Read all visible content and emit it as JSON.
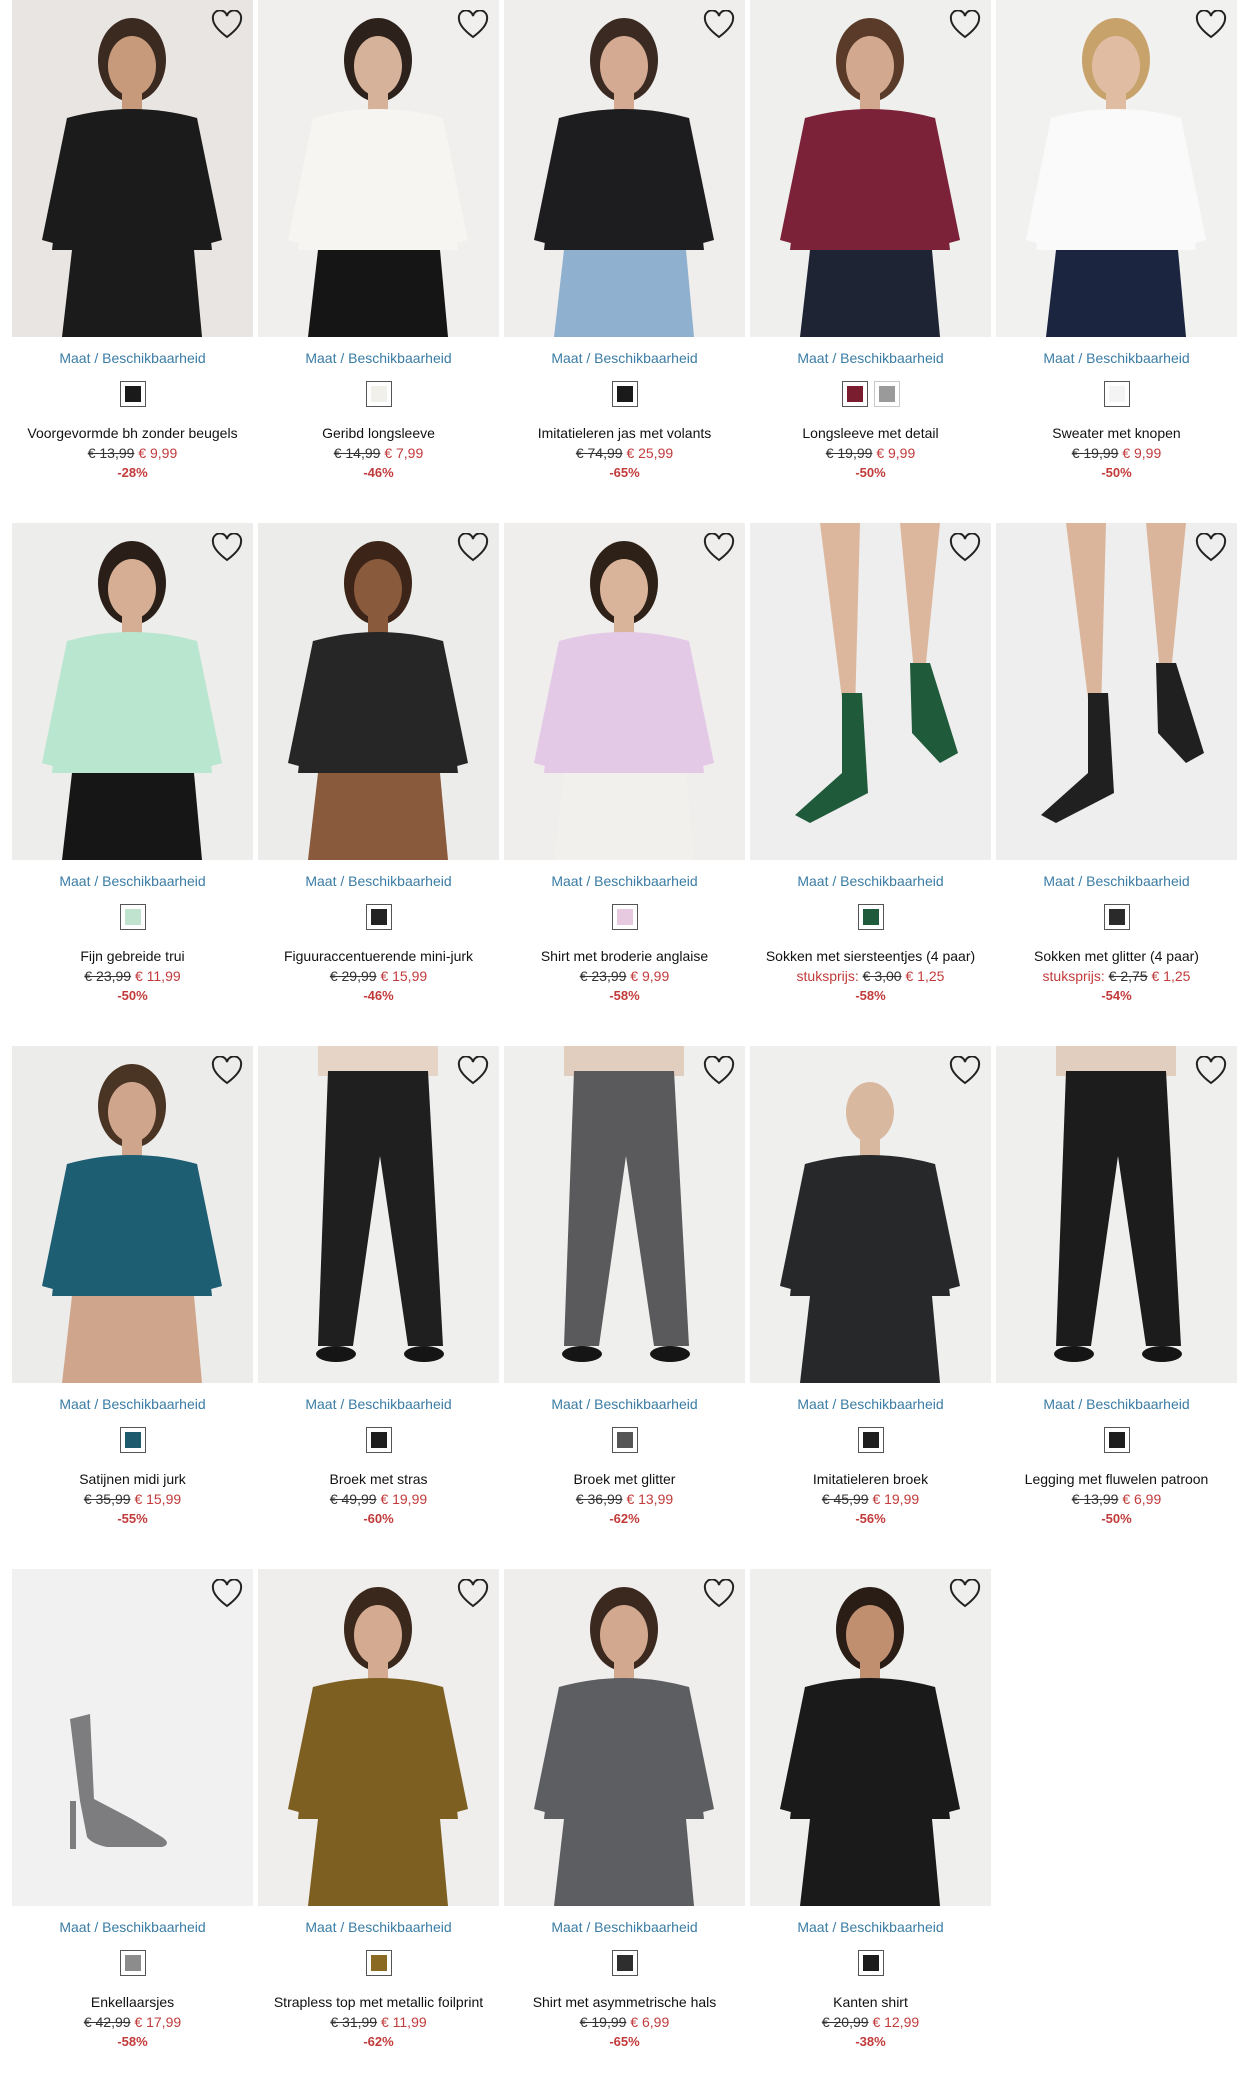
{
  "labels": {
    "size_link": "Maat / Beschikbaarheid"
  },
  "colors": {
    "link": "#3a7ca5",
    "sale": "#c23b3b"
  },
  "products": [
    {
      "title": "Voorgevormde bh zonder beugels",
      "old_price": "€ 13,99",
      "new_price": "€ 9,99",
      "discount": "-28%",
      "swatches": [
        "#1a1a1a"
      ],
      "bg": "#e9e5e2",
      "main": "#1b1b1b",
      "skin": "#c89a7c",
      "hair": "#3b2a20",
      "legs": "#1b1b1b"
    },
    {
      "title": "Geribd longsleeve",
      "old_price": "€ 14,99",
      "new_price": "€ 7,99",
      "discount": "-46%",
      "swatches": [
        "#f2f0ea"
      ],
      "bg": "#f0efed",
      "main": "#f6f5f1",
      "skin": "#d7b29a",
      "hair": "#2c211b",
      "legs": "#151515"
    },
    {
      "title": "Imitatieleren jas met volants",
      "old_price": "€ 74,99",
      "new_price": "€ 25,99",
      "discount": "-65%",
      "swatches": [
        "#1a1a1a"
      ],
      "bg": "#efeeec",
      "main": "#1d1d1f",
      "skin": "#d4ab92",
      "hair": "#3a2a22",
      "legs": "#8fb0cf"
    },
    {
      "title": "Longsleeve met detail",
      "old_price": "€ 19,99",
      "new_price": "€ 9,99",
      "discount": "-50%",
      "swatches": [
        "#7a1d2e",
        "#9a9a9a"
      ],
      "bg": "#efefee",
      "main": "#7c2238",
      "skin": "#d2a98e",
      "hair": "#5a3a28",
      "legs": "#1e2433"
    },
    {
      "title": "Sweater met knopen",
      "old_price": "€ 19,99",
      "new_price": "€ 9,99",
      "discount": "-50%",
      "swatches": [
        "#f4f4f4"
      ],
      "bg": "#f1f1f0",
      "main": "#fafafa",
      "skin": "#e0bda2",
      "hair": "#c7a26b",
      "legs": "#1b2540"
    },
    {
      "title": "Fijn gebreide trui",
      "old_price": "€ 23,99",
      "new_price": "€ 11,99",
      "discount": "-50%",
      "swatches": [
        "#bfe3cf"
      ],
      "bg": "#ededec",
      "main": "#b9e6cf",
      "skin": "#d6ae93",
      "hair": "#2a1e18",
      "legs": "#161616"
    },
    {
      "title": "Figuuraccentuerende mini-jurk",
      "old_price": "€ 29,99",
      "new_price": "€ 15,99",
      "discount": "-46%",
      "swatches": [
        "#222222"
      ],
      "bg": "#ececea",
      "main": "#262626",
      "skin": "#8a5a3d",
      "hair": "#3c2518",
      "legs": "#8a5a3d"
    },
    {
      "title": "Shirt met broderie anglaise",
      "old_price": "€ 23,99",
      "new_price": "€ 9,99",
      "discount": "-58%",
      "swatches": [
        "#e7c9e0"
      ],
      "bg": "#efeeec",
      "main": "#e3c9e6",
      "skin": "#d9b39a",
      "hair": "#2e2118",
      "legs": "#f2f0ec"
    },
    {
      "title": "Sokken met siersteentjes (4 paar)",
      "unit_label": "stuksprijs:",
      "old_price": "€ 3,00",
      "new_price": "€ 1,25",
      "discount": "-58%",
      "swatches": [
        "#1f5a3c"
      ],
      "bg": "#eeeeee",
      "main": "#1f5a3a",
      "skin": "#dcb79e",
      "hair": "#eeeeee",
      "legs": "#dcb79e"
    },
    {
      "title": "Sokken met glitter (4 paar)",
      "unit_label": "stuksprijs:",
      "old_price": "€ 2,75",
      "new_price": "€ 1,25",
      "discount": "-54%",
      "swatches": [
        "#2a2a2a"
      ],
      "bg": "#eeeeee",
      "main": "#202020",
      "skin": "#dab59c",
      "hair": "#eeeeee",
      "legs": "#dab59c"
    },
    {
      "title": "Satijnen midi jurk",
      "old_price": "€ 35,99",
      "new_price": "€ 15,99",
      "discount": "-55%",
      "swatches": [
        "#1e5a6e"
      ],
      "bg": "#ececeb",
      "main": "#1d5e72",
      "skin": "#cfa68b",
      "hair": "#4a3424",
      "legs": "#cfa68b"
    },
    {
      "title": "Broek met stras",
      "old_price": "€ 49,99",
      "new_price": "€ 19,99",
      "discount": "-60%",
      "swatches": [
        "#1e1e1e"
      ],
      "bg": "#efefee",
      "main": "#1f1f1f",
      "skin": "#e0c2ac",
      "hair": "#efefee",
      "legs": "#1f1f1f"
    },
    {
      "title": "Broek met glitter",
      "old_price": "€ 36,99",
      "new_price": "€ 13,99",
      "discount": "-62%",
      "swatches": [
        "#555555"
      ],
      "bg": "#efefee",
      "main": "#5a5a5c",
      "skin": "#d9b8a0",
      "hair": "#efefee",
      "legs": "#5a5a5c"
    },
    {
      "title": "Imitatieleren broek",
      "old_price": "€ 45,99",
      "new_price": "€ 19,99",
      "discount": "-56%",
      "swatches": [
        "#1e1e1e"
      ],
      "bg": "#efefee",
      "main": "#26282a",
      "skin": "#d9b8a0",
      "hair": "#efefee",
      "legs": "#26282a"
    },
    {
      "title": "Legging met fluwelen patroon",
      "old_price": "€ 13,99",
      "new_price": "€ 6,99",
      "discount": "-50%",
      "swatches": [
        "#1e1e1e"
      ],
      "bg": "#efefee",
      "main": "#1c1c1c",
      "skin": "#d9b8a0",
      "hair": "#efefee",
      "legs": "#1c1c1c"
    },
    {
      "title": "Enkellaarsjes",
      "old_price": "€ 42,99",
      "new_price": "€ 17,99",
      "discount": "-58%",
      "swatches": [
        "#8c8c8c"
      ],
      "bg": "#f1f1f1",
      "main": "#7d7d7f",
      "skin": "#f1f1f1",
      "hair": "#f1f1f1",
      "legs": "#f1f1f1"
    },
    {
      "title": "Strapless top met metallic foilprint",
      "old_price": "€ 31,99",
      "new_price": "€ 11,99",
      "discount": "-62%",
      "swatches": [
        "#8a6a22"
      ],
      "bg": "#efeeec",
      "main": "#7d5f22",
      "skin": "#d4ab90",
      "hair": "#3b281c",
      "legs": "#7d5f22"
    },
    {
      "title": "Shirt met asymmetrische hals",
      "old_price": "€ 19,99",
      "new_price": "€ 6,99",
      "discount": "-65%",
      "swatches": [
        "#2e2e2e"
      ],
      "bg": "#efeeec",
      "main": "#5c5e62",
      "skin": "#d2a98e",
      "hair": "#3b291f",
      "legs": "#5c5e62"
    },
    {
      "title": "Kanten shirt",
      "old_price": "€ 20,99",
      "new_price": "€ 12,99",
      "discount": "-38%",
      "swatches": [
        "#1b1b1b"
      ],
      "bg": "#efefee",
      "main": "#1a1a1a",
      "skin": "#bf8f70",
      "hair": "#2a1d16",
      "legs": "#1a1a1a"
    }
  ]
}
